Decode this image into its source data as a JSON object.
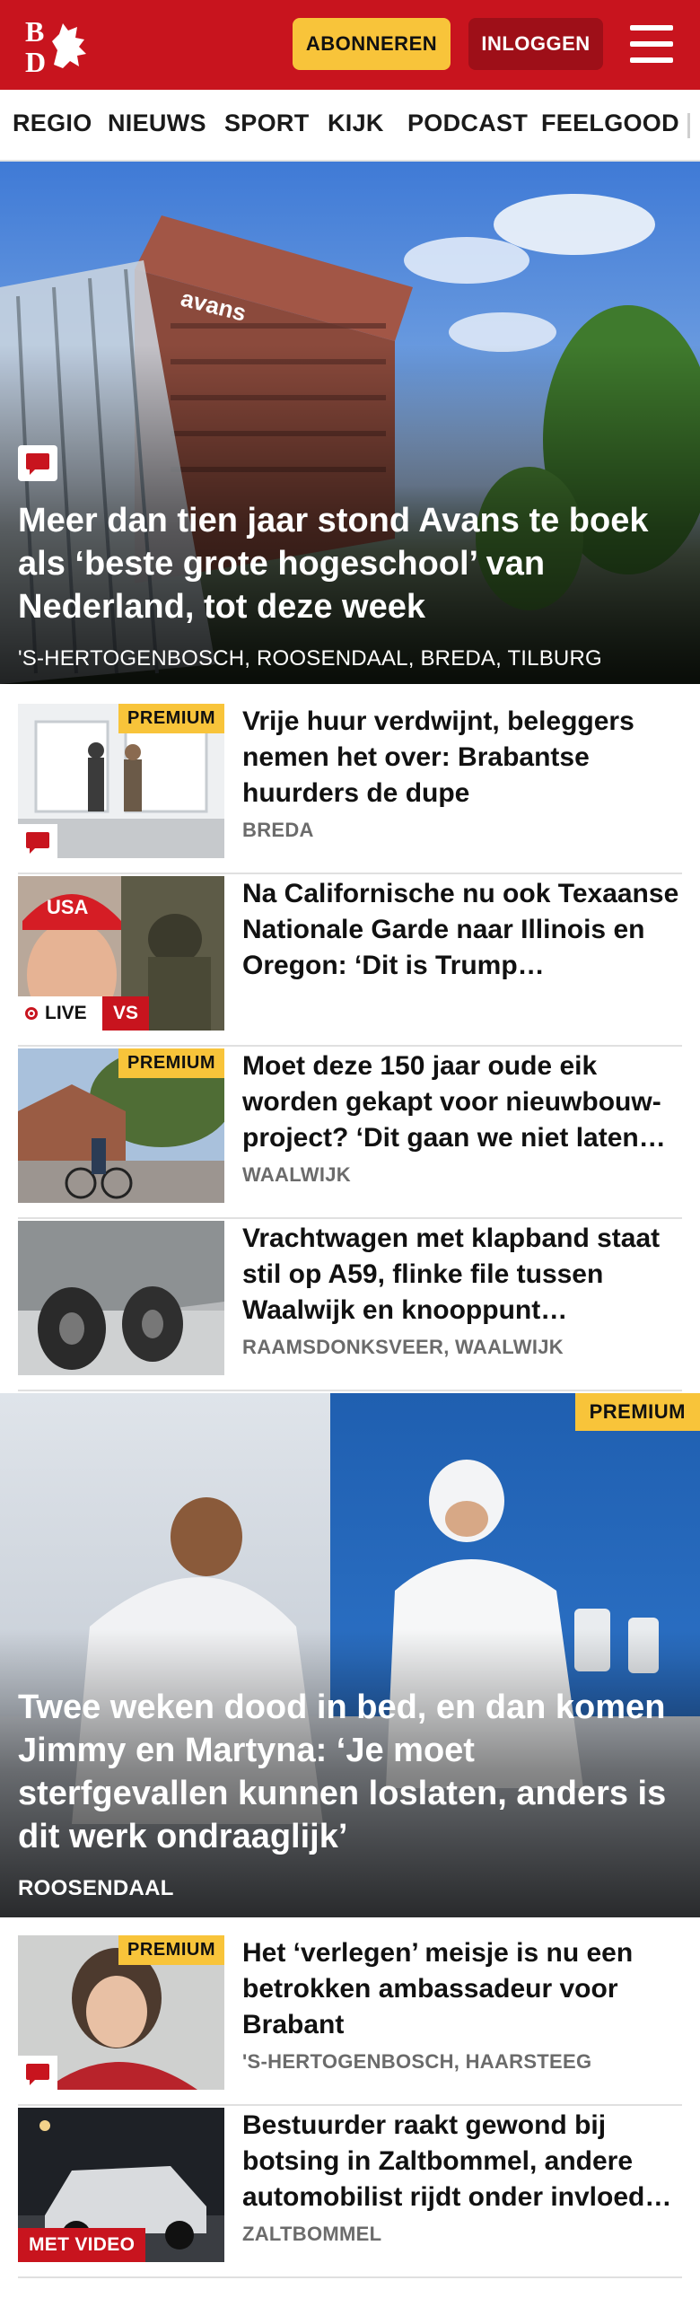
{
  "header": {
    "logo_text": "BD",
    "subscribe_label": "ABONNEREN",
    "login_label": "INLOGGEN",
    "brand_color": "#c8141e"
  },
  "nav": {
    "items": [
      "REGIO",
      "NIEUWS",
      "SPORT",
      "KIJK",
      "PODCAST",
      "FEELGOOD"
    ]
  },
  "hero": {
    "title": "Meer dan tien jaar stond Avans te boek als ‘beste grote hogeschool’ van Nederland, tot deze week",
    "locations": "'S-HERTOGENBOSCH, ROOSENDAAL, BREDA, TILBURG",
    "image_text": "avans",
    "icon": "comment-icon"
  },
  "articles": [
    {
      "title": "Vrije huur verdwijnt, beleggers nemen het over: Brabantse huurders de dupe",
      "location": "BREDA",
      "premium": "PREMIUM"
    },
    {
      "title": "Na Californische nu ook Texaanse Nationale Garde naar Illinois en Oregon: ‘Dit is Trump…",
      "location": "",
      "live": "LIVE",
      "vs": "VS",
      "image_text": "USA"
    },
    {
      "title": "Moet deze 150 jaar oude eik worden gekapt voor nieuwbouw-project? ‘Dit gaan we niet laten…",
      "location": "WAALWIJK",
      "premium": "PREMIUM"
    },
    {
      "title": "Vrachtwagen met klapband staat stil op A59, flinke file tussen Waalwijk en knooppunt…",
      "location": "RAAMSDONKSVEER, WAALWIJK"
    }
  ],
  "feature": {
    "premium": "PREMIUM",
    "title": "Twee weken dood in bed, en dan komen Jimmy en Martyna: ‘Je moet sterfgevallen kunnen loslaten, anders is dit werk ondraaglijk’",
    "location": "ROOSENDAAL"
  },
  "articles2": [
    {
      "title": "Het ‘verlegen’ meisje is nu een betrokken ambassadeur voor Brabant",
      "location": "'S-HERTOGENBOSCH, HAARSTEEG",
      "premium": "PREMIUM"
    },
    {
      "title": "Bestuurder raakt gewond bij botsing in Zaltbommel, andere automobilist rijdt onder invloed…",
      "location": "ZALTBOMMEL",
      "video": "MET VIDEO"
    }
  ]
}
